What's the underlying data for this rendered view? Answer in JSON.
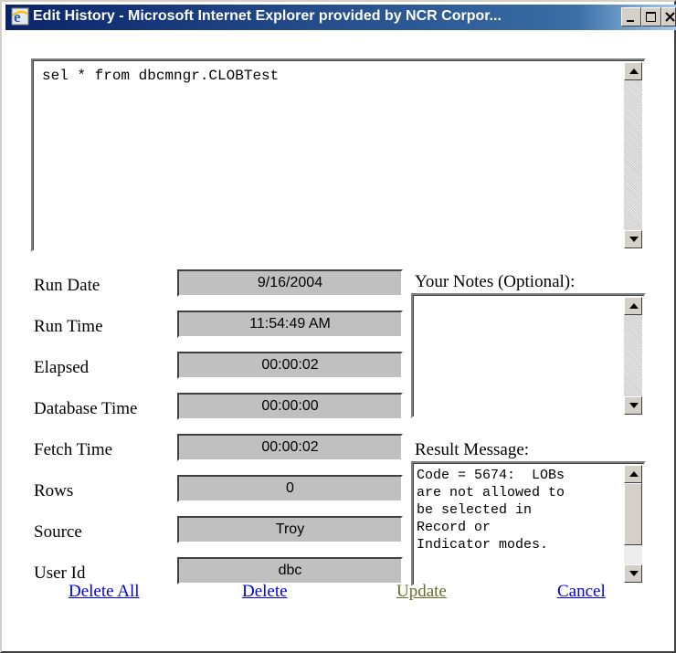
{
  "window": {
    "title": "Edit History - Microsoft Internet Explorer provided by NCR Corpor...",
    "minimize_label": "minimize",
    "maximize_label": "maximize",
    "close_label": "close"
  },
  "query": {
    "text": "sel * from dbcmngr.CLOBTest"
  },
  "fields": [
    {
      "label": "Run Date",
      "value": "9/16/2004"
    },
    {
      "label": "Run Time",
      "value": "11:54:49 AM"
    },
    {
      "label": "Elapsed",
      "value": "00:00:02"
    },
    {
      "label": "Database Time",
      "value": "00:00:00"
    },
    {
      "label": "Fetch Time",
      "value": "00:00:02"
    },
    {
      "label": "Rows",
      "value": "0"
    },
    {
      "label": "Source",
      "value": "Troy"
    },
    {
      "label": "User Id",
      "value": "dbc"
    }
  ],
  "notes": {
    "label": "Your Notes (Optional):",
    "value": ""
  },
  "result": {
    "label": "Result Message:",
    "text": "Code = 5674:  LOBs\nare not allowed to\nbe selected in\nRecord or\nIndicator modes."
  },
  "actions": {
    "delete_all": "Delete All",
    "delete": "Delete",
    "update": "Update",
    "cancel": "Cancel"
  },
  "colors": {
    "title_bar": "#0a246a",
    "field_bg": "#c0c0c0",
    "link": "#0000ee",
    "update_link": "#6b6b2a"
  },
  "icons": [
    "ie-icon",
    "minimize-icon",
    "maximize-icon",
    "close-icon",
    "scroll-up-arrow-icon",
    "scroll-down-arrow-icon"
  ]
}
